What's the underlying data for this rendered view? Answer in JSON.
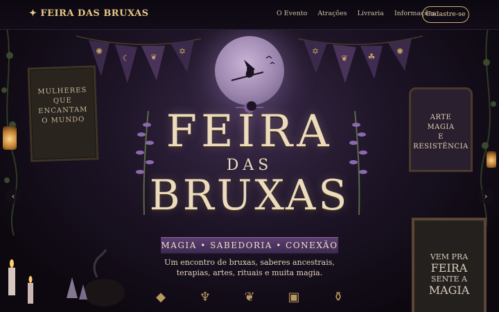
{
  "nav": {
    "brand_star": "✦",
    "brand": "FEIRA DAS BRUXAS",
    "links": [
      "O Evento",
      "Atrações",
      "Livraria",
      "Informações"
    ],
    "cta": "Cadastre-se"
  },
  "hero": {
    "title_top": "FEIRA",
    "title_mid": "DAS",
    "title_bottom": "BRUXAS",
    "ribbon": "MAGIA • SABEDORIA • CONEXÃO",
    "tagline_line1": "Um encontro de bruxas, saberes ancestrais,",
    "tagline_line2": "terapias, artes, rituais e muita magia.",
    "sign_left": [
      "MULHERES",
      "QUE",
      "ENCANTAM",
      "O MUNDO"
    ],
    "sign_right": [
      "ARTE",
      "MAGIA",
      "E",
      "RESISTÊNCIA"
    ],
    "board": [
      "VEM PRA",
      "FEIRA",
      "SENTE A",
      "MAGIA"
    ],
    "prev_arrow": "‹",
    "next_arrow": "›"
  },
  "feature_icons": [
    "crystal-icon",
    "chalice-icon",
    "herb-icon",
    "book-icon",
    "potion-icon"
  ],
  "colors": {
    "accent": "#d4b170",
    "title": "#ecdcbc",
    "ribbon": "#5b3f72"
  }
}
